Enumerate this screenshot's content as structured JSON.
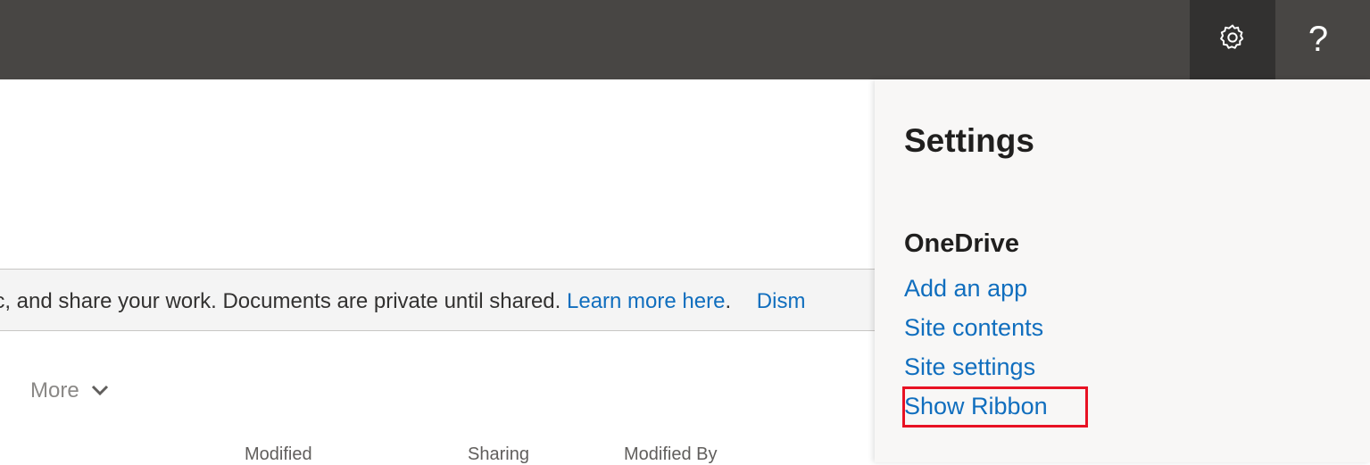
{
  "topbar": {
    "settings_icon": "gear-icon",
    "help_label": "?"
  },
  "banner": {
    "text": "ync, and share your work. Documents are private until shared.",
    "link_text": "Learn more here",
    "after_link": ".",
    "dismiss_text": "Dism"
  },
  "toolbar": {
    "more_label": "More",
    "more_icon": "chevron-down-icon"
  },
  "table": {
    "columns": [
      "Modified",
      "Sharing",
      "Modified By"
    ]
  },
  "settings_panel": {
    "title": "Settings",
    "section_title": "OneDrive",
    "links": [
      "Add an app",
      "Site contents",
      "Site settings",
      "Show Ribbon"
    ],
    "highlight_color": "#e81123"
  }
}
